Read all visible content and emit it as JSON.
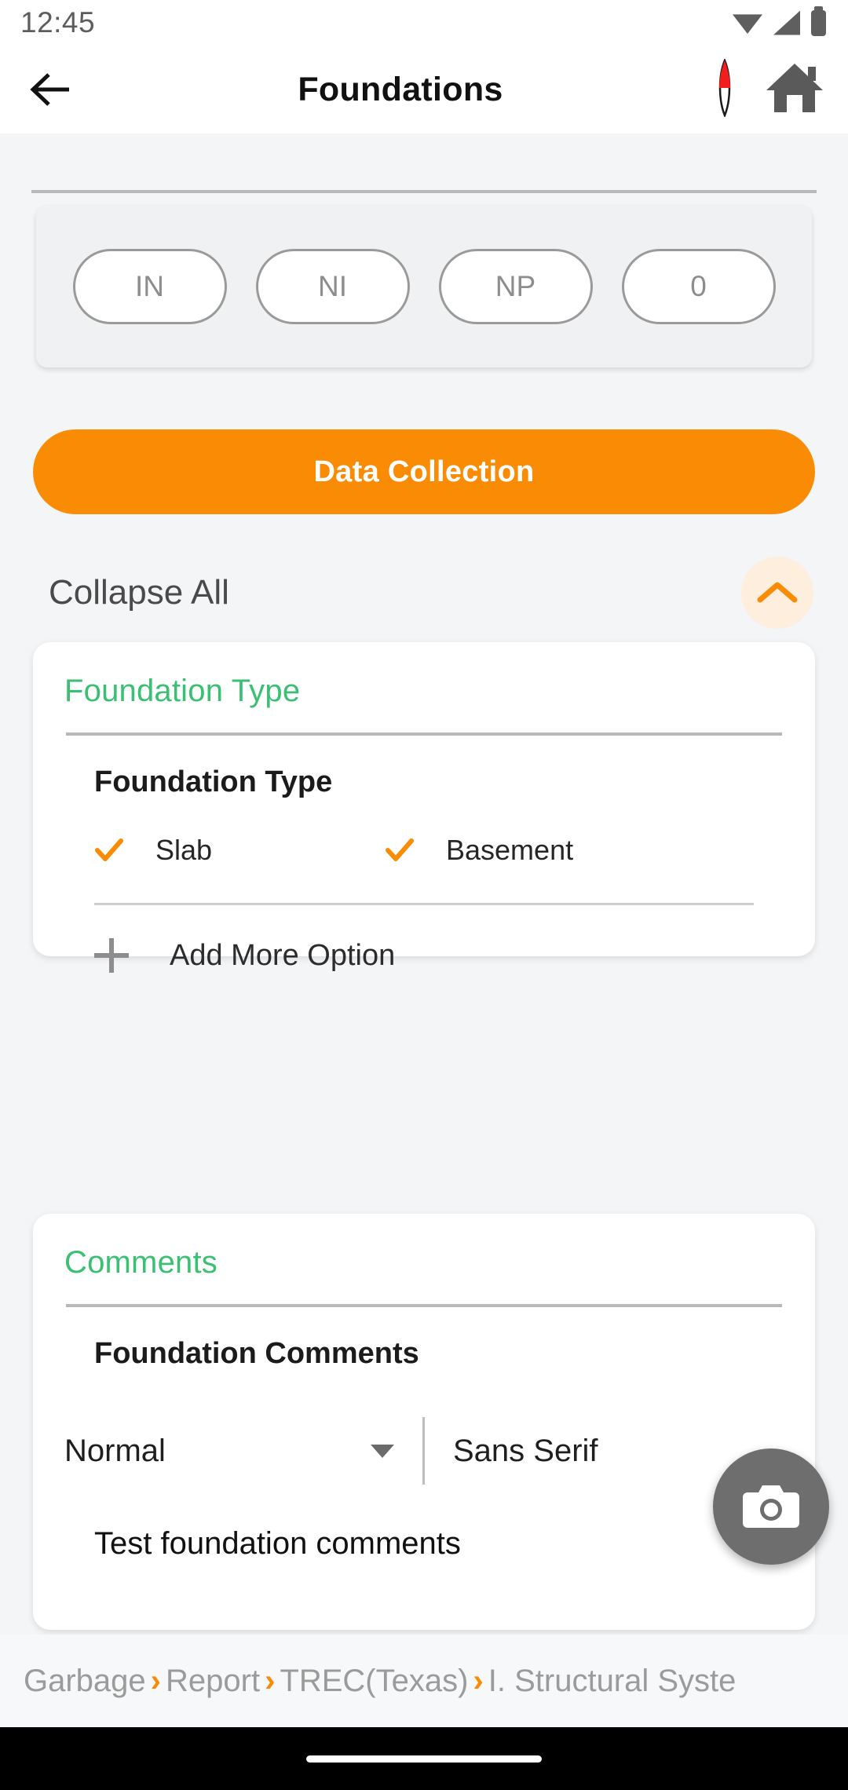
{
  "status_bar": {
    "time": "12:45",
    "icons": [
      "wifi-icon",
      "signal-icon",
      "battery-icon"
    ]
  },
  "app_bar": {
    "back_label": "back-arrow-icon",
    "title": "Foundations",
    "compass_label": "compass-icon",
    "home_label": "home-icon"
  },
  "rating_pills": [
    {
      "label": "IN"
    },
    {
      "label": "NI"
    },
    {
      "label": "NP"
    },
    {
      "label": "0"
    }
  ],
  "data_collection": {
    "label": "Data Collection"
  },
  "collapse": {
    "label": "Collapse All",
    "toggle_icon": "chevron-up-icon"
  },
  "cards": [
    {
      "title": "Foundation Type",
      "subtitle": "Foundation Type",
      "options": [
        {
          "label": "Slab",
          "checked": true
        },
        {
          "label": "Basement",
          "checked": true
        }
      ],
      "add_more_label": "Add More Option"
    },
    {
      "title": "Comments",
      "subtitle": "Foundation Comments",
      "toolbar": {
        "style_value": "Normal",
        "font_value": "Sans Serif"
      },
      "body_text": "Test foundation comments"
    }
  ],
  "camera_fab": {
    "icon": "camera-icon"
  },
  "breadcrumb": {
    "items": [
      "Garbage",
      "Report",
      "TREC(Texas)",
      "I. Structural Syste"
    ],
    "separator": "›"
  },
  "colors": {
    "accent_orange": "#fa8c05",
    "heading_green": "#3bbf72",
    "muted_gray": "#9b9b9b"
  }
}
